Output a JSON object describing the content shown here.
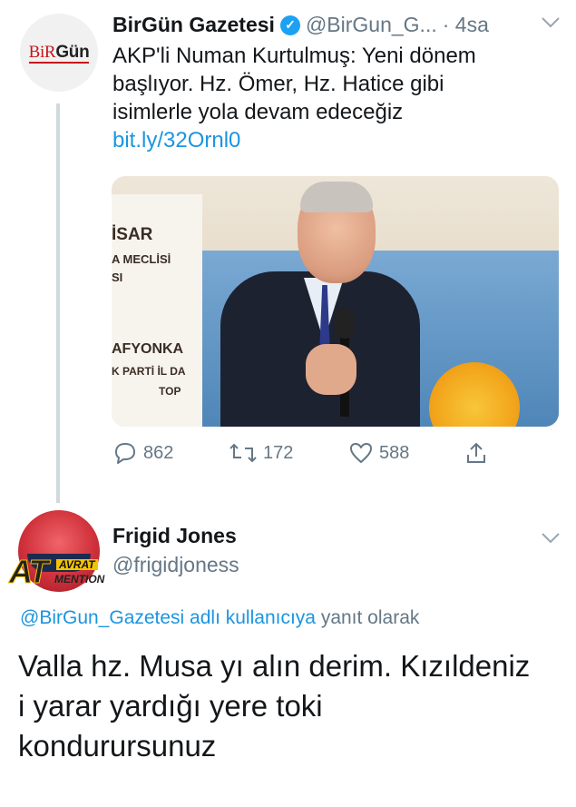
{
  "tweet1": {
    "avatar_logo_part1": "BiR",
    "avatar_logo_part2": "Gün",
    "author_name": "BirGün Gazetesi",
    "author_handle": "@BirGun_G...",
    "time": "· 4sa",
    "text_lines": [
      "AKP'li Numan Kurtulmuş: Yeni dönem",
      "başlıyor. Hz. Ömer, Hz. Hatice gibi",
      "isimlerle yola devam edeceğiz"
    ],
    "link": "bit.ly/32Ornl0",
    "photo_banner_lines": [
      "İSAR",
      "A MECLİSİ",
      "SI",
      "AFYONKA",
      "K PARTİ İL DA",
      "TOP"
    ],
    "reply_count": "862",
    "retweet_count": "172",
    "like_count": "588"
  },
  "tweet2": {
    "badge_big": "AT",
    "badge_small1": "AVRAT",
    "badge_small2": "MENTION",
    "author_name": "Frigid Jones",
    "author_handle": "@frigidjoness",
    "reply_to_handle": "@BirGun_Gazetesi adlı kullanıcıya",
    "reply_to_suffix": " yanıt olarak",
    "text_lines": [
      "Valla hz. Musa yı alın derim. Kızıldeniz",
      "i yarar yardığı yere toki",
      "kondurursunuz"
    ]
  },
  "colors": {
    "accent": "#1b95e0",
    "muted": "#657786",
    "text": "#14171a",
    "verified": "#1da1f2"
  },
  "icons": {
    "verified": "verified-badge-icon",
    "chevron": "chevron-down-icon",
    "reply": "reply-icon",
    "retweet": "retweet-icon",
    "like": "heart-icon",
    "share": "share-icon"
  }
}
